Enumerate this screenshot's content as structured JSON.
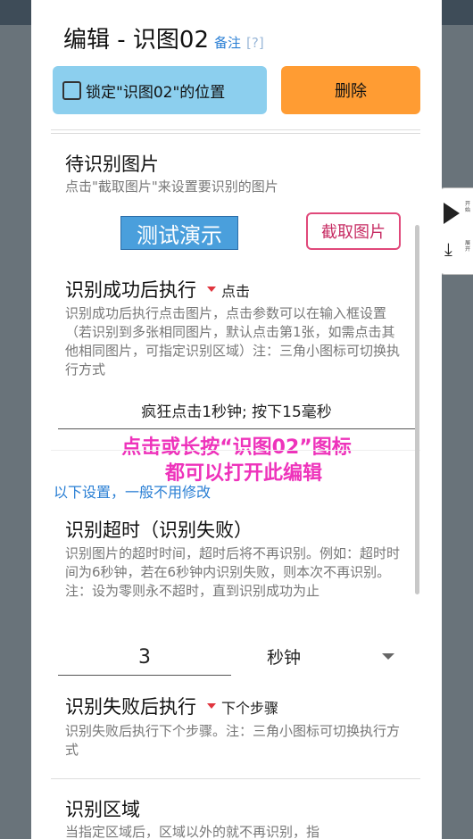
{
  "dialog": {
    "title": "编辑 - 识图02",
    "note_link": "备注",
    "help_link": "[?]",
    "lock_button": "锁定\"识图02\"的位置",
    "delete_button": "删除"
  },
  "image_section": {
    "title": "待识别图片",
    "desc": "点击\"截取图片\"来设置要识别的图片",
    "demo_label": "测试演示",
    "capture_button": "截取图片"
  },
  "success_section": {
    "title": "识别成功后执行",
    "mode": "点击",
    "desc": "识别成功后执行点击图片，点击参数可以在输入框设置（若识别到多张相同图片，默认点击第1张，如需点击其他相同图片，可指定识别区域）注：三角小图标可切换执行方式",
    "action_value": "疯狂点击1秒钟; 按下15毫秒"
  },
  "overlay": {
    "line1": "点击或长按“识图02”图标",
    "line2": "都可以打开此编辑"
  },
  "blue_note": "以下设置，一般不用修改",
  "timeout_section": {
    "title": "识别超时（识别失败）",
    "desc": "识别图片的超时时间，超时后将不再识别。例如：超时时间为6秒钟，若在6秒钟内识别失败，则本次不再识别。注：设为零则永不超时，直到识别成功为止",
    "value": "3",
    "unit": "秒钟"
  },
  "fail_section": {
    "title": "识别失败后执行",
    "mode": "下个步骤",
    "desc": "识别失败后执行下个步骤。注：三角小图标可切换执行方式"
  },
  "region_section": {
    "title": "识别区域",
    "desc": "当指定区域后，区域以外的就不再识别，指"
  },
  "float_widget": {
    "play_label": "开始",
    "expand_label": "展开"
  }
}
